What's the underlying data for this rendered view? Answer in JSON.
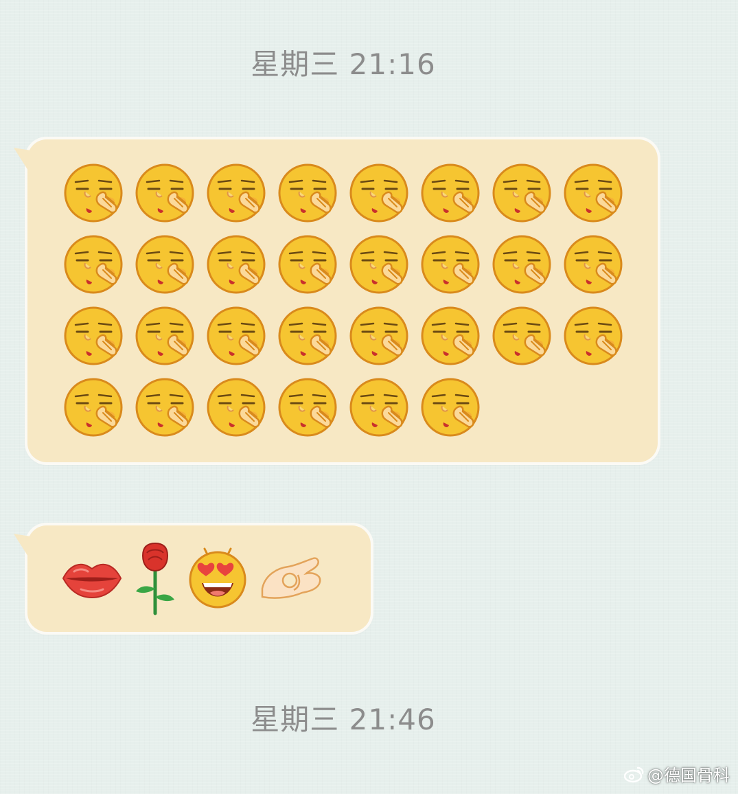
{
  "timestamps": {
    "first": "星期三 21:16",
    "second": "星期三 21:46"
  },
  "messages": [
    {
      "type": "emoji-grid",
      "emoji_name": "smirk-hand-over-mouth-face",
      "count": 30,
      "columns": 8
    },
    {
      "type": "emoji-row",
      "emojis": [
        "kissing-lips",
        "rose",
        "heart-eyes-face",
        "ok-hand"
      ]
    }
  ],
  "watermark": {
    "text": "@德国骨科"
  },
  "colors": {
    "background": "#e6efec",
    "bubble": "#f7e8c4",
    "timestamp_text": "#8c8c8c",
    "emoji_face": "#f6c531",
    "emoji_outline": "#d98a1c"
  }
}
